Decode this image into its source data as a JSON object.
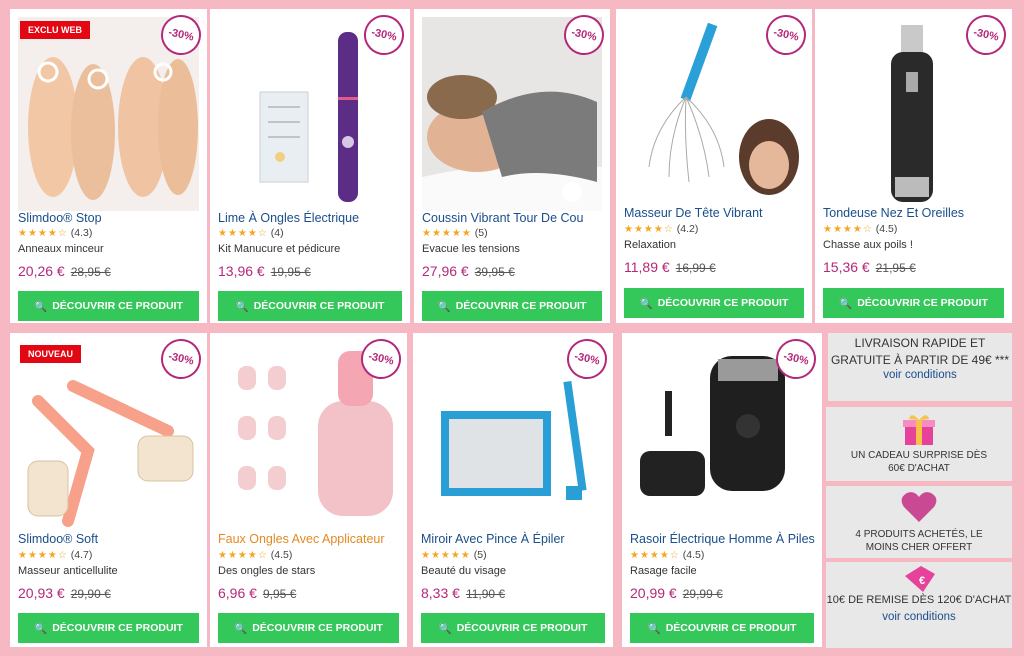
{
  "button_label": "DÉCOUVRIR CE PRODUIT",
  "colors": {
    "accent": "#b4287a",
    "button": "#34c759",
    "background": "#f6b9c4",
    "badge": "#e30613"
  },
  "products": [
    {
      "name": "Slimdoo® Stop",
      "rating": "(4.3)",
      "stars": "★★★★☆",
      "subtitle": "Anneaux minceur",
      "price": "20,26 €",
      "old_price": "28,95 €",
      "discount": "-30%",
      "badge": "EXCLU WEB"
    },
    {
      "name": "Lime À Ongles Électrique",
      "rating": "(4)",
      "stars": "★★★★☆",
      "subtitle": "Kit Manucure et pédicure",
      "price": "13,96 €",
      "old_price": "19,95 €",
      "discount": "-30%"
    },
    {
      "name": "Coussin Vibrant Tour De Cou",
      "rating": "(5)",
      "stars": "★★★★★",
      "subtitle": "Evacue les tensions",
      "price": "27,96 €",
      "old_price": "39,95 €",
      "discount": "-30%"
    },
    {
      "name": "Masseur De Tête Vibrant",
      "rating": "(4.2)",
      "stars": "★★★★☆",
      "subtitle": "Relaxation",
      "price": "11,89 €",
      "old_price": "16,99 €",
      "discount": "-30%"
    },
    {
      "name": "Tondeuse Nez Et Oreilles",
      "rating": "(4.5)",
      "stars": "★★★★☆",
      "subtitle": "Chasse aux poils !",
      "price": "15,36 €",
      "old_price": "21,95 €",
      "discount": "-30%"
    },
    {
      "name": "Slimdoo® Soft",
      "rating": "(4.7)",
      "stars": "★★★★☆",
      "subtitle": "Masseur anticellulite",
      "price": "20,93 €",
      "old_price": "29,90 €",
      "discount": "-30%",
      "badge": "NOUVEAU"
    },
    {
      "name": "Faux Ongles Avec Applicateur",
      "rating": "(4.5)",
      "stars": "★★★★☆",
      "subtitle": "Des ongles de stars",
      "price": "6,96 €",
      "old_price": "9,95 €",
      "discount": "-30%"
    },
    {
      "name": "Miroir Avec Pince À Épiler",
      "rating": "(5)",
      "stars": "★★★★★",
      "subtitle": "Beauté du visage",
      "price": "8,33 €",
      "old_price": "11,90 €",
      "discount": "-30%"
    },
    {
      "name": "Rasoir Électrique Homme À Piles",
      "rating": "(4.5)",
      "stars": "★★★★☆",
      "subtitle": "Rasage facile",
      "price": "20,99 €",
      "old_price": "29,99 €",
      "discount": "-30%"
    }
  ],
  "info": {
    "shipping": {
      "text": "LIVRAISON RAPIDE ET GRATUITE À PARTIR DE 49€ ***",
      "link": "voir conditions"
    },
    "gift": {
      "icon": "gift-icon",
      "text": "UN CADEAU SURPRISE DÈS 60€ D'ACHAT"
    },
    "offer": {
      "icon": "heart-icon",
      "text": "4 PRODUITS ACHETÉS, LE MOINS CHER OFFERT"
    },
    "discount": {
      "icon": "euro-tag-icon",
      "text": "10€ DE REMISE DÈS 120€ D'ACHAT",
      "link": "voir conditions"
    }
  }
}
